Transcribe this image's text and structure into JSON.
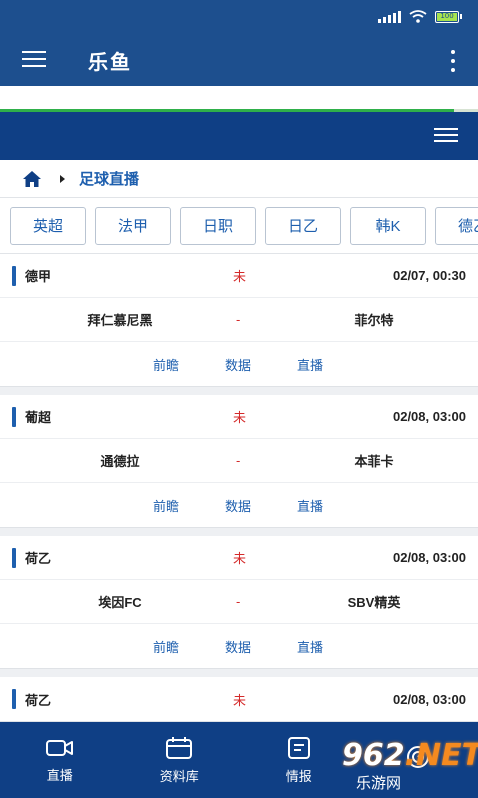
{
  "statusbar": {
    "battery_label": "100"
  },
  "appbar": {
    "title": "乐鱼"
  },
  "load_progress_fraction": 0.95,
  "breadcrumb": {
    "current": "足球直播"
  },
  "tabs": [
    "英超",
    "法甲",
    "日职",
    "日乙",
    "韩K",
    "德乙"
  ],
  "matches": [
    {
      "league": "德甲",
      "status": "未",
      "datetime": "02/07, 00:30",
      "home": "拜仁慕尼黑",
      "vs": "-",
      "away": "菲尔特",
      "links": [
        "前瞻",
        "数据",
        "直播"
      ]
    },
    {
      "league": "葡超",
      "status": "未",
      "datetime": "02/08, 03:00",
      "home": "通德拉",
      "vs": "-",
      "away": "本菲卡",
      "links": [
        "前瞻",
        "数据",
        "直播"
      ]
    },
    {
      "league": "荷乙",
      "status": "未",
      "datetime": "02/08, 03:00",
      "home": "埃因FC",
      "vs": "-",
      "away": "SBV精英",
      "links": [
        "前瞻",
        "数据",
        "直播"
      ]
    },
    {
      "league": "荷乙",
      "status": "未",
      "datetime": "02/08, 03:00"
    }
  ],
  "bottom_nav": [
    {
      "label": "直播",
      "icon": "video-icon"
    },
    {
      "label": "资料库",
      "icon": "calendar-icon"
    },
    {
      "label": "情报",
      "icon": "document-icon"
    },
    {
      "label": "",
      "icon": "target-icon"
    }
  ],
  "watermark": {
    "number": "962",
    "suffix": ".NET",
    "text": "乐游网"
  },
  "colors": {
    "primary": "#1d4f8e",
    "nav": "#0f3f85",
    "link": "#1e5fae",
    "status": "#d42a2a",
    "progress": "#2fb04a"
  }
}
